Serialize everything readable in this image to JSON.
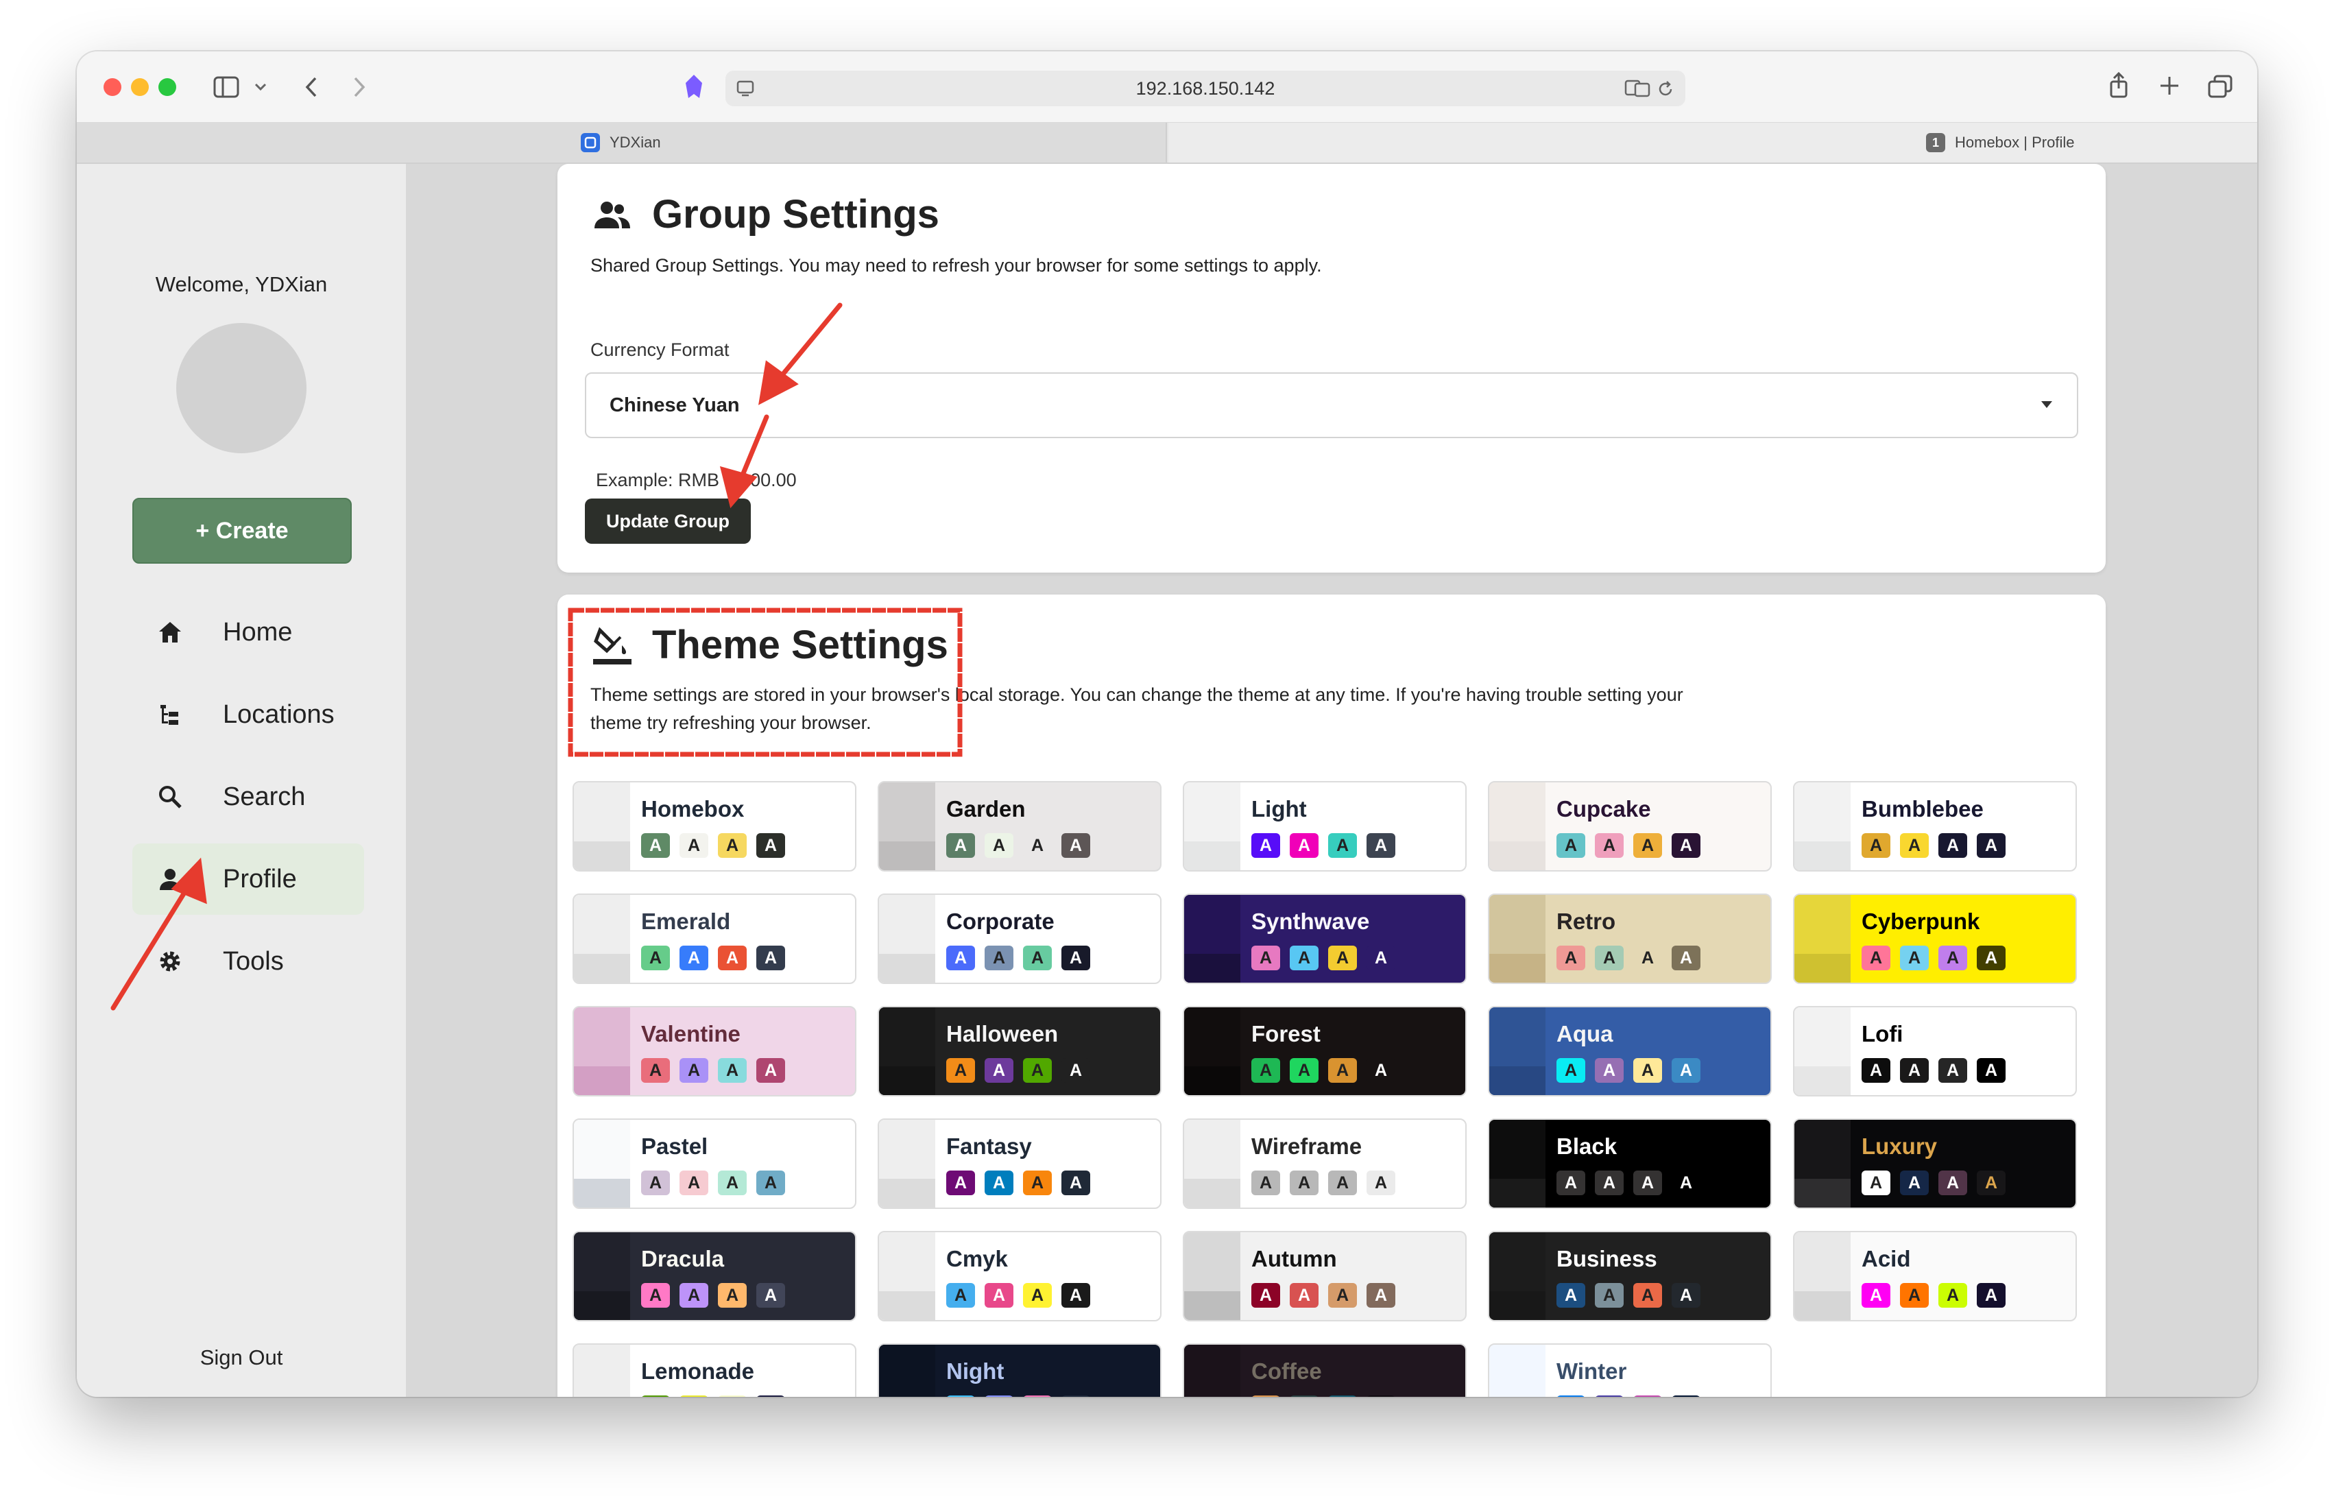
{
  "browser": {
    "address": "192.168.150.142",
    "tabs": [
      {
        "label": "YDXian",
        "favicon_color": "#2f6fe0"
      },
      {
        "label": "Homebox | Profile",
        "favicon_color": "#6b6b6b",
        "favicon_text": "1"
      }
    ]
  },
  "sidebar": {
    "welcome": "Welcome, YDXian",
    "create_label": "+ Create",
    "nav": [
      {
        "label": "Home",
        "icon": "home-icon"
      },
      {
        "label": "Locations",
        "icon": "locations-icon"
      },
      {
        "label": "Search",
        "icon": "search-icon"
      },
      {
        "label": "Profile",
        "icon": "person-icon",
        "active": true
      },
      {
        "label": "Tools",
        "icon": "gear-icon"
      }
    ],
    "sign_out": "Sign Out"
  },
  "group_settings": {
    "title": "Group Settings",
    "description": "Shared Group Settings. You may need to refresh your browser for some settings to apply.",
    "currency_label": "Currency Format",
    "currency_value": "Chinese Yuan",
    "example": "Example: RMB 1,000.00",
    "update_label": "Update Group"
  },
  "theme_settings": {
    "title": "Theme Settings",
    "description_line1": "Theme settings are stored in your browser's local storage. You can change the theme at any time. If you're having trouble setting your",
    "description_line2": "theme try refreshing your browser.",
    "themes": [
      {
        "name": "Homebox",
        "bg": "#ffffff",
        "fg": "#1f2937",
        "top": "#eeeeee",
        "bot": "#dcdcdc",
        "sw": [
          [
            "#5f8a66",
            "#fff"
          ],
          [
            "#f3f3ee",
            "#222"
          ],
          [
            "#f6d860",
            "#222"
          ],
          [
            "#2c2f2a",
            "#fff"
          ]
        ]
      },
      {
        "name": "Garden",
        "bg": "#e9e7e7",
        "fg": "#100f0f",
        "top": "#cfcdcd",
        "bot": "#bebcbc",
        "sw": [
          [
            "#5c7f67",
            "#fff"
          ],
          [
            "#ecf4e7",
            "#222"
          ],
          [
            "#e9e7e7",
            "#222"
          ],
          [
            "#5d5656",
            "#fff"
          ]
        ]
      },
      {
        "name": "Light",
        "bg": "#ffffff",
        "fg": "#1f2937",
        "top": "#f2f2f2",
        "bot": "#e5e6e6",
        "sw": [
          [
            "#570df8",
            "#fff"
          ],
          [
            "#f000b8",
            "#fff"
          ],
          [
            "#37cdbe",
            "#222"
          ],
          [
            "#3d4451",
            "#fff"
          ]
        ]
      },
      {
        "name": "Cupcake",
        "bg": "#faf7f5",
        "fg": "#291334",
        "top": "#efeae6",
        "bot": "#e7e2df",
        "sw": [
          [
            "#65c3c8",
            "#222"
          ],
          [
            "#ef9fbc",
            "#222"
          ],
          [
            "#eeaf3a",
            "#222"
          ],
          [
            "#291334",
            "#fff"
          ]
        ]
      },
      {
        "name": "Bumblebee",
        "bg": "#ffffff",
        "fg": "#181830",
        "top": "#f2f2f2",
        "bot": "#e5e6e6",
        "sw": [
          [
            "#e0a82e",
            "#222"
          ],
          [
            "#f9d72f",
            "#222"
          ],
          [
            "#181830",
            "#fff"
          ],
          [
            "#181830",
            "#fff"
          ]
        ]
      },
      {
        "name": "Emerald",
        "bg": "#ffffff",
        "fg": "#333c4d",
        "top": "#eeeeee",
        "bot": "#dcdcdc",
        "sw": [
          [
            "#66cc8a",
            "#222"
          ],
          [
            "#377cfb",
            "#fff"
          ],
          [
            "#ea5234",
            "#fff"
          ],
          [
            "#333c4d",
            "#fff"
          ]
        ]
      },
      {
        "name": "Corporate",
        "bg": "#ffffff",
        "fg": "#181a2a",
        "top": "#eeeeee",
        "bot": "#dcdcdc",
        "sw": [
          [
            "#4b6bfb",
            "#fff"
          ],
          [
            "#7b92b2",
            "#222"
          ],
          [
            "#67cba0",
            "#222"
          ],
          [
            "#181a2a",
            "#fff"
          ]
        ]
      },
      {
        "name": "Synthwave",
        "bg": "#2d1b69",
        "fg": "#f9f7fd",
        "top": "#241456",
        "bot": "#1a103d",
        "sw": [
          [
            "#e779c1",
            "#222"
          ],
          [
            "#58c7f3",
            "#222"
          ],
          [
            "#f3cc30",
            "#222"
          ],
          [
            "#2d1b69",
            "#fff"
          ]
        ]
      },
      {
        "name": "Retro",
        "bg": "#e4d8b4",
        "fg": "#282425",
        "top": "#d2c59d",
        "bot": "#c6b386",
        "sw": [
          [
            "#ef9995",
            "#222"
          ],
          [
            "#a4cbb4",
            "#222"
          ],
          [
            "#e4d8b4",
            "#222"
          ],
          [
            "#7d7259",
            "#fff"
          ]
        ]
      },
      {
        "name": "Cyberpunk",
        "bg": "#ffee00",
        "fg": "#000000",
        "top": "#e6d63a",
        "bot": "#cfc130",
        "sw": [
          [
            "#ff7598",
            "#222"
          ],
          [
            "#75d1f0",
            "#222"
          ],
          [
            "#c07eec",
            "#222"
          ],
          [
            "#423f00",
            "#fff"
          ]
        ]
      },
      {
        "name": "Valentine",
        "bg": "#f0d6e8",
        "fg": "#632c3b",
        "top": "#e0b8d4",
        "bot": "#d39fc4",
        "sw": [
          [
            "#e96d7b",
            "#222"
          ],
          [
            "#a991f7",
            "#222"
          ],
          [
            "#88dbdd",
            "#222"
          ],
          [
            "#af4670",
            "#fff"
          ]
        ]
      },
      {
        "name": "Halloween",
        "bg": "#212121",
        "fg": "#f5f5f5",
        "top": "#1a1a1a",
        "bot": "#141414",
        "sw": [
          [
            "#f28c18",
            "#222"
          ],
          [
            "#6d3a9c",
            "#fff"
          ],
          [
            "#51a800",
            "#222"
          ],
          [
            "#212121",
            "#fff"
          ]
        ]
      },
      {
        "name": "Forest",
        "bg": "#171212",
        "fg": "#f5f5f5",
        "top": "#110d0d",
        "bot": "#0a0808",
        "sw": [
          [
            "#1eb854",
            "#222"
          ],
          [
            "#1fd65f",
            "#222"
          ],
          [
            "#d99330",
            "#222"
          ],
          [
            "#171212",
            "#fff"
          ]
        ]
      },
      {
        "name": "Aqua",
        "bg": "#345da7",
        "fg": "#f5f5f5",
        "top": "#2f5495",
        "bot": "#284883",
        "sw": [
          [
            "#09ecf3",
            "#222"
          ],
          [
            "#966fb3",
            "#fff"
          ],
          [
            "#ffe999",
            "#222"
          ],
          [
            "#3b8ac4",
            "#fff"
          ]
        ]
      },
      {
        "name": "Lofi",
        "bg": "#ffffff",
        "fg": "#000000",
        "top": "#f2f2f2",
        "bot": "#e6e6e6",
        "sw": [
          [
            "#0d0d0d",
            "#fff"
          ],
          [
            "#1a1919",
            "#fff"
          ],
          [
            "#262626",
            "#fff"
          ],
          [
            "#000000",
            "#fff"
          ]
        ]
      },
      {
        "name": "Pastel",
        "bg": "#ffffff",
        "fg": "#1f2937",
        "top": "#f9fafb",
        "bot": "#d1d5db",
        "sw": [
          [
            "#d1c1d7",
            "#222"
          ],
          [
            "#f6cbd1",
            "#222"
          ],
          [
            "#b4e9d6",
            "#222"
          ],
          [
            "#70acc7",
            "#222"
          ]
        ]
      },
      {
        "name": "Fantasy",
        "bg": "#ffffff",
        "fg": "#1f2937",
        "top": "#eeeeee",
        "bot": "#dcdcdc",
        "sw": [
          [
            "#6e0b75",
            "#fff"
          ],
          [
            "#007ebd",
            "#fff"
          ],
          [
            "#f8860d",
            "#222"
          ],
          [
            "#1f2937",
            "#fff"
          ]
        ]
      },
      {
        "name": "Wireframe",
        "bg": "#ffffff",
        "fg": "#282828",
        "top": "#eeeeee",
        "bot": "#dcdcdc",
        "sw": [
          [
            "#b8b8b8",
            "#222"
          ],
          [
            "#b8b8b8",
            "#222"
          ],
          [
            "#b8b8b8",
            "#222"
          ],
          [
            "#ebebeb",
            "#222"
          ]
        ]
      },
      {
        "name": "Black",
        "bg": "#000000",
        "fg": "#ffffff",
        "top": "#0d0d0d",
        "bot": "#1a1a1a",
        "sw": [
          [
            "#343232",
            "#fff"
          ],
          [
            "#343232",
            "#fff"
          ],
          [
            "#343232",
            "#fff"
          ],
          [
            "#000000",
            "#fff"
          ]
        ]
      },
      {
        "name": "Luxury",
        "bg": "#09090b",
        "fg": "#dca54c",
        "top": "#171618",
        "bot": "#2e2d2f",
        "sw": [
          [
            "#ffffff",
            "#222"
          ],
          [
            "#152747",
            "#fff"
          ],
          [
            "#513448",
            "#fff"
          ],
          [
            "#171618",
            "#dca54c"
          ]
        ]
      },
      {
        "name": "Dracula",
        "bg": "#282a36",
        "fg": "#f8f8f2",
        "top": "#21222c",
        "bot": "#181920",
        "sw": [
          [
            "#ff79c6",
            "#222"
          ],
          [
            "#bd93f9",
            "#222"
          ],
          [
            "#ffb86c",
            "#222"
          ],
          [
            "#414558",
            "#fff"
          ]
        ]
      },
      {
        "name": "Cmyk",
        "bg": "#ffffff",
        "fg": "#1f2937",
        "top": "#eeeeee",
        "bot": "#dcdcdc",
        "sw": [
          [
            "#45aeee",
            "#222"
          ],
          [
            "#e8488a",
            "#fff"
          ],
          [
            "#fff232",
            "#222"
          ],
          [
            "#1a1a1a",
            "#fff"
          ]
        ]
      },
      {
        "name": "Autumn",
        "bg": "#f1f1f1",
        "fg": "#141414",
        "top": "#d8d8d8",
        "bot": "#bdbdbd",
        "sw": [
          [
            "#8c0327",
            "#fff"
          ],
          [
            "#d85251",
            "#fff"
          ],
          [
            "#d59b6a",
            "#222"
          ],
          [
            "#826a5c",
            "#fff"
          ]
        ]
      },
      {
        "name": "Business",
        "bg": "#202020",
        "fg": "#ffffff",
        "top": "#1c1c1c",
        "bot": "#181818",
        "sw": [
          [
            "#1c4e80",
            "#fff"
          ],
          [
            "#7c909a",
            "#222"
          ],
          [
            "#ea6947",
            "#222"
          ],
          [
            "#23282e",
            "#fff"
          ]
        ]
      },
      {
        "name": "Acid",
        "bg": "#fafafa",
        "fg": "#1f2937",
        "top": "#e8e8e8",
        "bot": "#d6d6d6",
        "sw": [
          [
            "#ff00f4",
            "#fff"
          ],
          [
            "#ff7400",
            "#222"
          ],
          [
            "#cbfd03",
            "#222"
          ],
          [
            "#140f2d",
            "#fff"
          ]
        ]
      },
      {
        "name": "Lemonade",
        "bg": "#ffffff",
        "fg": "#1f2937",
        "top": "#eeeeee",
        "bot": "#dcdcdc",
        "sw": [
          [
            "#519903",
            "#222"
          ],
          [
            "#e9e92e",
            "#222"
          ],
          [
            "#f7f9ca",
            "#222"
          ],
          [
            "#191a3e",
            "#fff"
          ]
        ]
      },
      {
        "name": "Night",
        "bg": "#0f1729",
        "fg": "#b3c5ef",
        "top": "#0c1322",
        "bot": "#091019",
        "sw": [
          [
            "#38bdf8",
            "#222"
          ],
          [
            "#818cf8",
            "#222"
          ],
          [
            "#f471b5",
            "#222"
          ],
          [
            "#1e293b",
            "#fff"
          ]
        ]
      },
      {
        "name": "Coffee",
        "bg": "#20161f",
        "fg": "#756e63",
        "top": "#1b121a",
        "bot": "#150e14",
        "sw": [
          [
            "#db924b",
            "#222"
          ],
          [
            "#263e3f",
            "#fff"
          ],
          [
            "#10576d",
            "#fff"
          ],
          [
            "#120c12",
            "#fff"
          ]
        ]
      },
      {
        "name": "Winter",
        "bg": "#ffffff",
        "fg": "#394e6a",
        "top": "#f2f7ff",
        "bot": "#e3e9f4",
        "sw": [
          [
            "#047aed",
            "#fff"
          ],
          [
            "#463aa2",
            "#fff"
          ],
          [
            "#c148ac",
            "#fff"
          ],
          [
            "#021431",
            "#fff"
          ]
        ]
      }
    ]
  }
}
